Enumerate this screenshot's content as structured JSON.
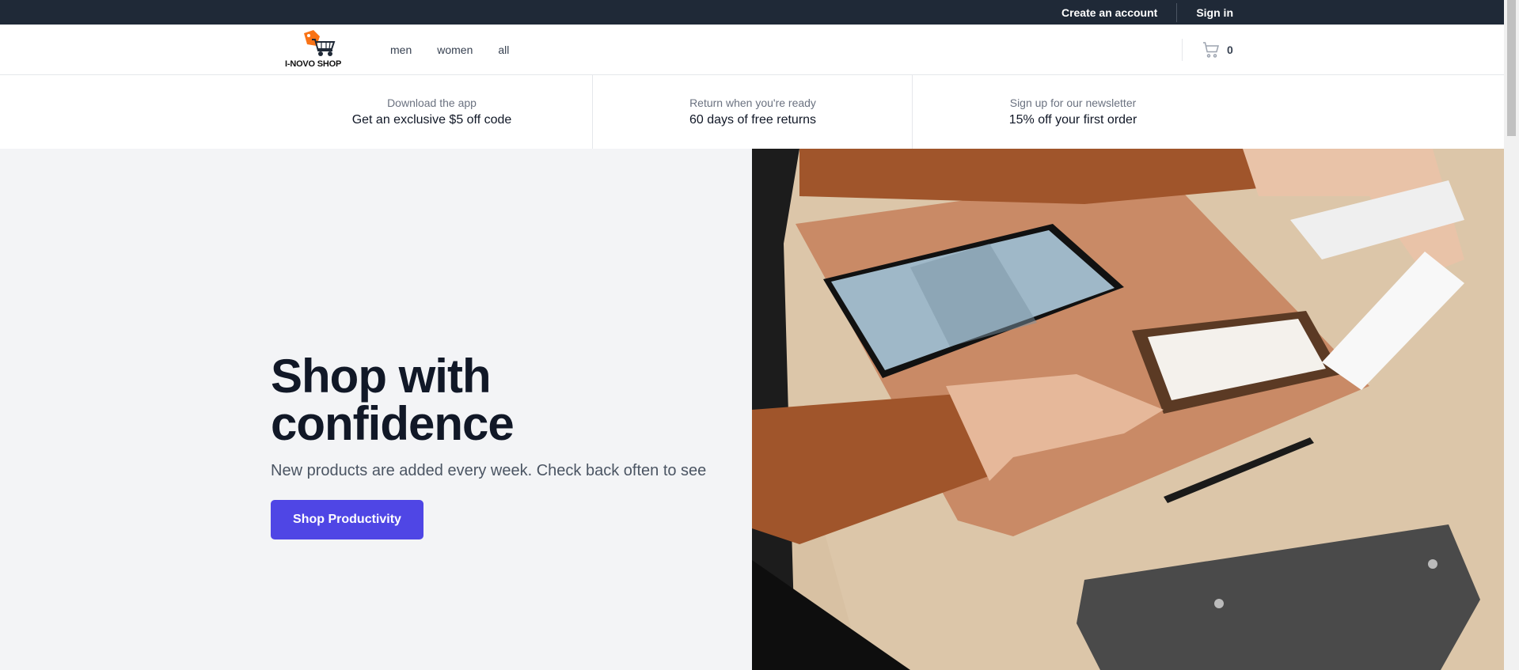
{
  "topbar": {
    "create_account": "Create an account",
    "sign_in": "Sign in"
  },
  "header": {
    "logo_text": "I-NOVO SHOP",
    "nav": [
      "men",
      "women",
      "all"
    ],
    "cart_count": "0"
  },
  "perks": [
    {
      "small": "Download the app",
      "big": "Get an exclusive $5 off code"
    },
    {
      "small": "Return when you're ready",
      "big": "60 days of free returns"
    },
    {
      "small": "Sign up for our newsletter",
      "big": "15% off your first order"
    }
  ],
  "hero": {
    "title_line1": "Shop with",
    "title_line2": "confidence",
    "subtitle": "New products are added every week. Check back often to see",
    "button": "Shop Productivity"
  },
  "colors": {
    "topbar_bg": "#1f2937",
    "accent": "#4f46e5",
    "hero_bg": "#f3f4f6",
    "logo_orange": "#f97316"
  },
  "icons": [
    "shopping-cart-logo-icon",
    "shopping-bag-icon"
  ]
}
